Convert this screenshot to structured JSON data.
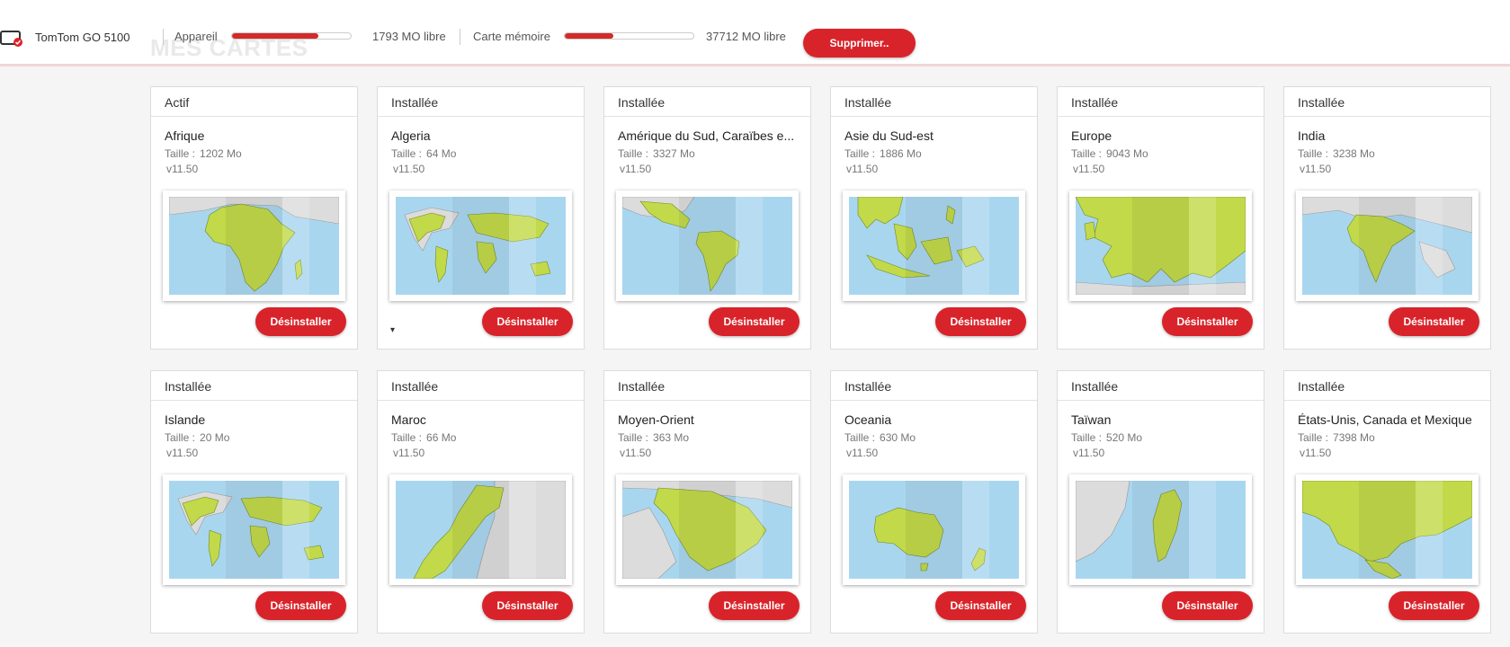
{
  "device": {
    "name": "TomTom GO 5100",
    "icon": "device-icon"
  },
  "storage": {
    "device_label": "Appareil",
    "device_free": "1793 MO",
    "device_used_fraction": 0.73,
    "card_label": "Carte mémoire",
    "card_free": "37712 MO",
    "card_used_fraction": 0.38,
    "free_suffix": "libre"
  },
  "delete_label": "Supprimer..",
  "page_title": "MES CARTES",
  "size_label": "Taille :",
  "uninstall_label": "Désinstaller",
  "colors": {
    "accent": "#d9232a",
    "land": "#c2d94a",
    "sea": "#a9d6ef"
  },
  "maps": [
    {
      "status": "Actif",
      "name": "Afrique",
      "size": "1202 Mo",
      "version": "v11.50",
      "region": "africa"
    },
    {
      "status": "Installée",
      "name": "Algeria",
      "size": "64 Mo",
      "version": "v11.50",
      "region": "world",
      "chevron": "▾"
    },
    {
      "status": "Installée",
      "name": "Amérique du Sud, Caraïbes e...",
      "size": "3327 Mo",
      "version": "v11.50",
      "region": "south-america"
    },
    {
      "status": "Installée",
      "name": "Asie du Sud-est",
      "size": "1886 Mo",
      "version": "v11.50",
      "region": "se-asia"
    },
    {
      "status": "Installée",
      "name": "Europe",
      "size": "9043 Mo",
      "version": "v11.50",
      "region": "europe"
    },
    {
      "status": "Installée",
      "name": "India",
      "size": "3238 Mo",
      "version": "v11.50",
      "region": "india"
    },
    {
      "status": "Installée",
      "name": "Islande",
      "size": "20 Mo",
      "version": "v11.50",
      "region": "world"
    },
    {
      "status": "Installée",
      "name": "Maroc",
      "size": "66 Mo",
      "version": "v11.50",
      "region": "morocco"
    },
    {
      "status": "Installée",
      "name": "Moyen-Orient",
      "size": "363 Mo",
      "version": "v11.50",
      "region": "middle-east"
    },
    {
      "status": "Installée",
      "name": "Oceania",
      "size": "630 Mo",
      "version": "v11.50",
      "region": "oceania"
    },
    {
      "status": "Installée",
      "name": "Taïwan",
      "size": "520 Mo",
      "version": "v11.50",
      "region": "taiwan"
    },
    {
      "status": "Installée",
      "name": "États-Unis, Canada et Mexique",
      "size": "7398 Mo",
      "version": "v11.50",
      "region": "north-america"
    }
  ]
}
